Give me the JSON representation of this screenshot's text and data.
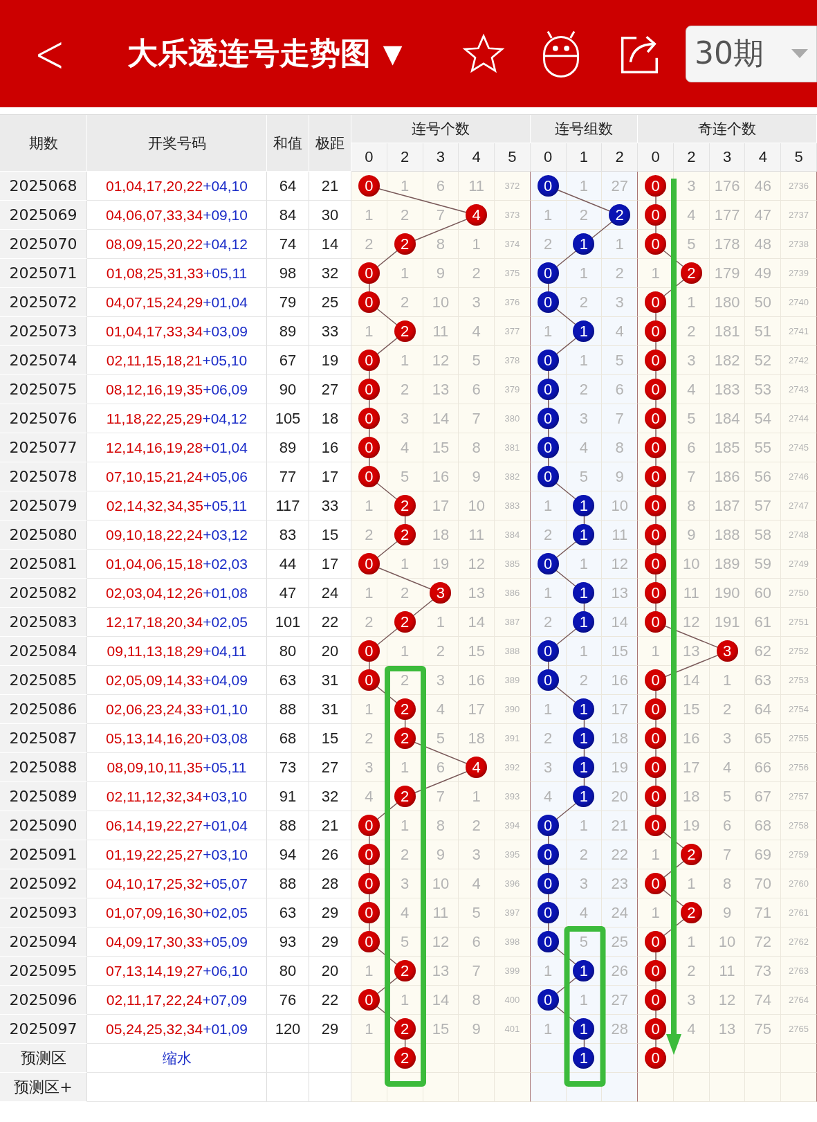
{
  "header": {
    "back": "<",
    "title": "大乐透连号走势图",
    "title_caret": "▼",
    "period": "30期"
  },
  "columns": {
    "issue": "期数",
    "numbers": "开奖号码",
    "sum": "和值",
    "span": "极距"
  },
  "groups": [
    {
      "title": "连号个数",
      "color": "#d40000",
      "columns": [
        "0",
        "2",
        "3",
        "4",
        "5"
      ]
    },
    {
      "title": "连号组数",
      "color": "#0a14b4",
      "columns": [
        "0",
        "1",
        "2"
      ]
    },
    {
      "title": "奇连个数",
      "color": "#d40000",
      "columns": [
        "0",
        "2",
        "3",
        "4",
        "5"
      ]
    }
  ],
  "rows": [
    {
      "issue": "2025068",
      "front": "01,04,17,20,22",
      "back": "+04,10",
      "sum": "64",
      "span": "21",
      "cells": [
        [
          {
            "text": "0",
            "hit": true
          },
          {
            "text": "1",
            "hit": false
          },
          {
            "text": "6",
            "hit": false
          },
          {
            "text": "11",
            "hit": false
          },
          {
            "text": "372",
            "hit": false
          }
        ],
        [
          {
            "text": "0",
            "hit": true
          },
          {
            "text": "1",
            "hit": false
          },
          {
            "text": "27",
            "hit": false
          }
        ],
        [
          {
            "text": "0",
            "hit": true
          },
          {
            "text": "3",
            "hit": false
          },
          {
            "text": "176",
            "hit": false
          },
          {
            "text": "46",
            "hit": false
          },
          {
            "text": "2736",
            "hit": false
          }
        ]
      ]
    },
    {
      "issue": "2025069",
      "front": "04,06,07,33,34",
      "back": "+09,10",
      "sum": "84",
      "span": "30",
      "cells": [
        [
          {
            "text": "1",
            "hit": false
          },
          {
            "text": "2",
            "hit": false
          },
          {
            "text": "7",
            "hit": false
          },
          {
            "text": "4",
            "hit": true
          },
          {
            "text": "373",
            "hit": false
          }
        ],
        [
          {
            "text": "1",
            "hit": false
          },
          {
            "text": "2",
            "hit": false
          },
          {
            "text": "2",
            "hit": true
          }
        ],
        [
          {
            "text": "0",
            "hit": true
          },
          {
            "text": "4",
            "hit": false
          },
          {
            "text": "177",
            "hit": false
          },
          {
            "text": "47",
            "hit": false
          },
          {
            "text": "2737",
            "hit": false
          }
        ]
      ]
    },
    {
      "issue": "2025070",
      "front": "08,09,15,20,22",
      "back": "+04,12",
      "sum": "74",
      "span": "14",
      "cells": [
        [
          {
            "text": "2",
            "hit": false
          },
          {
            "text": "2",
            "hit": true
          },
          {
            "text": "8",
            "hit": false
          },
          {
            "text": "1",
            "hit": false
          },
          {
            "text": "374",
            "hit": false
          }
        ],
        [
          {
            "text": "2",
            "hit": false
          },
          {
            "text": "1",
            "hit": true
          },
          {
            "text": "1",
            "hit": false
          }
        ],
        [
          {
            "text": "0",
            "hit": true
          },
          {
            "text": "5",
            "hit": false
          },
          {
            "text": "178",
            "hit": false
          },
          {
            "text": "48",
            "hit": false
          },
          {
            "text": "2738",
            "hit": false
          }
        ]
      ]
    },
    {
      "issue": "2025071",
      "front": "01,08,25,31,33",
      "back": "+05,11",
      "sum": "98",
      "span": "32",
      "cells": [
        [
          {
            "text": "0",
            "hit": true
          },
          {
            "text": "1",
            "hit": false
          },
          {
            "text": "9",
            "hit": false
          },
          {
            "text": "2",
            "hit": false
          },
          {
            "text": "375",
            "hit": false
          }
        ],
        [
          {
            "text": "0",
            "hit": true
          },
          {
            "text": "1",
            "hit": false
          },
          {
            "text": "2",
            "hit": false
          }
        ],
        [
          {
            "text": "1",
            "hit": false
          },
          {
            "text": "2",
            "hit": true
          },
          {
            "text": "179",
            "hit": false
          },
          {
            "text": "49",
            "hit": false
          },
          {
            "text": "2739",
            "hit": false
          }
        ]
      ]
    },
    {
      "issue": "2025072",
      "front": "04,07,15,24,29",
      "back": "+01,04",
      "sum": "79",
      "span": "25",
      "cells": [
        [
          {
            "text": "0",
            "hit": true
          },
          {
            "text": "2",
            "hit": false
          },
          {
            "text": "10",
            "hit": false
          },
          {
            "text": "3",
            "hit": false
          },
          {
            "text": "376",
            "hit": false
          }
        ],
        [
          {
            "text": "0",
            "hit": true
          },
          {
            "text": "2",
            "hit": false
          },
          {
            "text": "3",
            "hit": false
          }
        ],
        [
          {
            "text": "0",
            "hit": true
          },
          {
            "text": "1",
            "hit": false
          },
          {
            "text": "180",
            "hit": false
          },
          {
            "text": "50",
            "hit": false
          },
          {
            "text": "2740",
            "hit": false
          }
        ]
      ]
    },
    {
      "issue": "2025073",
      "front": "01,04,17,33,34",
      "back": "+03,09",
      "sum": "89",
      "span": "33",
      "cells": [
        [
          {
            "text": "1",
            "hit": false
          },
          {
            "text": "2",
            "hit": true
          },
          {
            "text": "11",
            "hit": false
          },
          {
            "text": "4",
            "hit": false
          },
          {
            "text": "377",
            "hit": false
          }
        ],
        [
          {
            "text": "1",
            "hit": false
          },
          {
            "text": "1",
            "hit": true
          },
          {
            "text": "4",
            "hit": false
          }
        ],
        [
          {
            "text": "0",
            "hit": true
          },
          {
            "text": "2",
            "hit": false
          },
          {
            "text": "181",
            "hit": false
          },
          {
            "text": "51",
            "hit": false
          },
          {
            "text": "2741",
            "hit": false
          }
        ]
      ]
    },
    {
      "issue": "2025074",
      "front": "02,11,15,18,21",
      "back": "+05,10",
      "sum": "67",
      "span": "19",
      "cells": [
        [
          {
            "text": "0",
            "hit": true
          },
          {
            "text": "1",
            "hit": false
          },
          {
            "text": "12",
            "hit": false
          },
          {
            "text": "5",
            "hit": false
          },
          {
            "text": "378",
            "hit": false
          }
        ],
        [
          {
            "text": "0",
            "hit": true
          },
          {
            "text": "1",
            "hit": false
          },
          {
            "text": "5",
            "hit": false
          }
        ],
        [
          {
            "text": "0",
            "hit": true
          },
          {
            "text": "3",
            "hit": false
          },
          {
            "text": "182",
            "hit": false
          },
          {
            "text": "52",
            "hit": false
          },
          {
            "text": "2742",
            "hit": false
          }
        ]
      ]
    },
    {
      "issue": "2025075",
      "front": "08,12,16,19,35",
      "back": "+06,09",
      "sum": "90",
      "span": "27",
      "cells": [
        [
          {
            "text": "0",
            "hit": true
          },
          {
            "text": "2",
            "hit": false
          },
          {
            "text": "13",
            "hit": false
          },
          {
            "text": "6",
            "hit": false
          },
          {
            "text": "379",
            "hit": false
          }
        ],
        [
          {
            "text": "0",
            "hit": true
          },
          {
            "text": "2",
            "hit": false
          },
          {
            "text": "6",
            "hit": false
          }
        ],
        [
          {
            "text": "0",
            "hit": true
          },
          {
            "text": "4",
            "hit": false
          },
          {
            "text": "183",
            "hit": false
          },
          {
            "text": "53",
            "hit": false
          },
          {
            "text": "2743",
            "hit": false
          }
        ]
      ]
    },
    {
      "issue": "2025076",
      "front": "11,18,22,25,29",
      "back": "+04,12",
      "sum": "105",
      "span": "18",
      "cells": [
        [
          {
            "text": "0",
            "hit": true
          },
          {
            "text": "3",
            "hit": false
          },
          {
            "text": "14",
            "hit": false
          },
          {
            "text": "7",
            "hit": false
          },
          {
            "text": "380",
            "hit": false
          }
        ],
        [
          {
            "text": "0",
            "hit": true
          },
          {
            "text": "3",
            "hit": false
          },
          {
            "text": "7",
            "hit": false
          }
        ],
        [
          {
            "text": "0",
            "hit": true
          },
          {
            "text": "5",
            "hit": false
          },
          {
            "text": "184",
            "hit": false
          },
          {
            "text": "54",
            "hit": false
          },
          {
            "text": "2744",
            "hit": false
          }
        ]
      ]
    },
    {
      "issue": "2025077",
      "front": "12,14,16,19,28",
      "back": "+01,04",
      "sum": "89",
      "span": "16",
      "cells": [
        [
          {
            "text": "0",
            "hit": true
          },
          {
            "text": "4",
            "hit": false
          },
          {
            "text": "15",
            "hit": false
          },
          {
            "text": "8",
            "hit": false
          },
          {
            "text": "381",
            "hit": false
          }
        ],
        [
          {
            "text": "0",
            "hit": true
          },
          {
            "text": "4",
            "hit": false
          },
          {
            "text": "8",
            "hit": false
          }
        ],
        [
          {
            "text": "0",
            "hit": true
          },
          {
            "text": "6",
            "hit": false
          },
          {
            "text": "185",
            "hit": false
          },
          {
            "text": "55",
            "hit": false
          },
          {
            "text": "2745",
            "hit": false
          }
        ]
      ]
    },
    {
      "issue": "2025078",
      "front": "07,10,15,21,24",
      "back": "+05,06",
      "sum": "77",
      "span": "17",
      "cells": [
        [
          {
            "text": "0",
            "hit": true
          },
          {
            "text": "5",
            "hit": false
          },
          {
            "text": "16",
            "hit": false
          },
          {
            "text": "9",
            "hit": false
          },
          {
            "text": "382",
            "hit": false
          }
        ],
        [
          {
            "text": "0",
            "hit": true
          },
          {
            "text": "5",
            "hit": false
          },
          {
            "text": "9",
            "hit": false
          }
        ],
        [
          {
            "text": "0",
            "hit": true
          },
          {
            "text": "7",
            "hit": false
          },
          {
            "text": "186",
            "hit": false
          },
          {
            "text": "56",
            "hit": false
          },
          {
            "text": "2746",
            "hit": false
          }
        ]
      ]
    },
    {
      "issue": "2025079",
      "front": "02,14,32,34,35",
      "back": "+05,11",
      "sum": "117",
      "span": "33",
      "cells": [
        [
          {
            "text": "1",
            "hit": false
          },
          {
            "text": "2",
            "hit": true
          },
          {
            "text": "17",
            "hit": false
          },
          {
            "text": "10",
            "hit": false
          },
          {
            "text": "383",
            "hit": false
          }
        ],
        [
          {
            "text": "1",
            "hit": false
          },
          {
            "text": "1",
            "hit": true
          },
          {
            "text": "10",
            "hit": false
          }
        ],
        [
          {
            "text": "0",
            "hit": true
          },
          {
            "text": "8",
            "hit": false
          },
          {
            "text": "187",
            "hit": false
          },
          {
            "text": "57",
            "hit": false
          },
          {
            "text": "2747",
            "hit": false
          }
        ]
      ]
    },
    {
      "issue": "2025080",
      "front": "09,10,18,22,24",
      "back": "+03,12",
      "sum": "83",
      "span": "15",
      "cells": [
        [
          {
            "text": "2",
            "hit": false
          },
          {
            "text": "2",
            "hit": true
          },
          {
            "text": "18",
            "hit": false
          },
          {
            "text": "11",
            "hit": false
          },
          {
            "text": "384",
            "hit": false
          }
        ],
        [
          {
            "text": "2",
            "hit": false
          },
          {
            "text": "1",
            "hit": true
          },
          {
            "text": "11",
            "hit": false
          }
        ],
        [
          {
            "text": "0",
            "hit": true
          },
          {
            "text": "9",
            "hit": false
          },
          {
            "text": "188",
            "hit": false
          },
          {
            "text": "58",
            "hit": false
          },
          {
            "text": "2748",
            "hit": false
          }
        ]
      ]
    },
    {
      "issue": "2025081",
      "front": "01,04,06,15,18",
      "back": "+02,03",
      "sum": "44",
      "span": "17",
      "cells": [
        [
          {
            "text": "0",
            "hit": true
          },
          {
            "text": "1",
            "hit": false
          },
          {
            "text": "19",
            "hit": false
          },
          {
            "text": "12",
            "hit": false
          },
          {
            "text": "385",
            "hit": false
          }
        ],
        [
          {
            "text": "0",
            "hit": true
          },
          {
            "text": "1",
            "hit": false
          },
          {
            "text": "12",
            "hit": false
          }
        ],
        [
          {
            "text": "0",
            "hit": true
          },
          {
            "text": "10",
            "hit": false
          },
          {
            "text": "189",
            "hit": false
          },
          {
            "text": "59",
            "hit": false
          },
          {
            "text": "2749",
            "hit": false
          }
        ]
      ]
    },
    {
      "issue": "2025082",
      "front": "02,03,04,12,26",
      "back": "+01,08",
      "sum": "47",
      "span": "24",
      "cells": [
        [
          {
            "text": "1",
            "hit": false
          },
          {
            "text": "2",
            "hit": false
          },
          {
            "text": "3",
            "hit": true
          },
          {
            "text": "13",
            "hit": false
          },
          {
            "text": "386",
            "hit": false
          }
        ],
        [
          {
            "text": "1",
            "hit": false
          },
          {
            "text": "1",
            "hit": true
          },
          {
            "text": "13",
            "hit": false
          }
        ],
        [
          {
            "text": "0",
            "hit": true
          },
          {
            "text": "11",
            "hit": false
          },
          {
            "text": "190",
            "hit": false
          },
          {
            "text": "60",
            "hit": false
          },
          {
            "text": "2750",
            "hit": false
          }
        ]
      ]
    },
    {
      "issue": "2025083",
      "front": "12,17,18,20,34",
      "back": "+02,05",
      "sum": "101",
      "span": "22",
      "cells": [
        [
          {
            "text": "2",
            "hit": false
          },
          {
            "text": "2",
            "hit": true
          },
          {
            "text": "1",
            "hit": false
          },
          {
            "text": "14",
            "hit": false
          },
          {
            "text": "387",
            "hit": false
          }
        ],
        [
          {
            "text": "2",
            "hit": false
          },
          {
            "text": "1",
            "hit": true
          },
          {
            "text": "14",
            "hit": false
          }
        ],
        [
          {
            "text": "0",
            "hit": true
          },
          {
            "text": "12",
            "hit": false
          },
          {
            "text": "191",
            "hit": false
          },
          {
            "text": "61",
            "hit": false
          },
          {
            "text": "2751",
            "hit": false
          }
        ]
      ]
    },
    {
      "issue": "2025084",
      "front": "09,11,13,18,29",
      "back": "+04,11",
      "sum": "80",
      "span": "20",
      "cells": [
        [
          {
            "text": "0",
            "hit": true
          },
          {
            "text": "1",
            "hit": false
          },
          {
            "text": "2",
            "hit": false
          },
          {
            "text": "15",
            "hit": false
          },
          {
            "text": "388",
            "hit": false
          }
        ],
        [
          {
            "text": "0",
            "hit": true
          },
          {
            "text": "1",
            "hit": false
          },
          {
            "text": "15",
            "hit": false
          }
        ],
        [
          {
            "text": "1",
            "hit": false
          },
          {
            "text": "13",
            "hit": false
          },
          {
            "text": "3",
            "hit": true
          },
          {
            "text": "62",
            "hit": false
          },
          {
            "text": "2752",
            "hit": false
          }
        ]
      ]
    },
    {
      "issue": "2025085",
      "front": "02,05,09,14,33",
      "back": "+04,09",
      "sum": "63",
      "span": "31",
      "cells": [
        [
          {
            "text": "0",
            "hit": true
          },
          {
            "text": "2",
            "hit": false
          },
          {
            "text": "3",
            "hit": false
          },
          {
            "text": "16",
            "hit": false
          },
          {
            "text": "389",
            "hit": false
          }
        ],
        [
          {
            "text": "0",
            "hit": true
          },
          {
            "text": "2",
            "hit": false
          },
          {
            "text": "16",
            "hit": false
          }
        ],
        [
          {
            "text": "0",
            "hit": true
          },
          {
            "text": "14",
            "hit": false
          },
          {
            "text": "1",
            "hit": false
          },
          {
            "text": "63",
            "hit": false
          },
          {
            "text": "2753",
            "hit": false
          }
        ]
      ]
    },
    {
      "issue": "2025086",
      "front": "02,06,23,24,33",
      "back": "+01,10",
      "sum": "88",
      "span": "31",
      "cells": [
        [
          {
            "text": "1",
            "hit": false
          },
          {
            "text": "2",
            "hit": true
          },
          {
            "text": "4",
            "hit": false
          },
          {
            "text": "17",
            "hit": false
          },
          {
            "text": "390",
            "hit": false
          }
        ],
        [
          {
            "text": "1",
            "hit": false
          },
          {
            "text": "1",
            "hit": true
          },
          {
            "text": "17",
            "hit": false
          }
        ],
        [
          {
            "text": "0",
            "hit": true
          },
          {
            "text": "15",
            "hit": false
          },
          {
            "text": "2",
            "hit": false
          },
          {
            "text": "64",
            "hit": false
          },
          {
            "text": "2754",
            "hit": false
          }
        ]
      ]
    },
    {
      "issue": "2025087",
      "front": "05,13,14,16,20",
      "back": "+03,08",
      "sum": "68",
      "span": "15",
      "cells": [
        [
          {
            "text": "2",
            "hit": false
          },
          {
            "text": "2",
            "hit": true
          },
          {
            "text": "5",
            "hit": false
          },
          {
            "text": "18",
            "hit": false
          },
          {
            "text": "391",
            "hit": false
          }
        ],
        [
          {
            "text": "2",
            "hit": false
          },
          {
            "text": "1",
            "hit": true
          },
          {
            "text": "18",
            "hit": false
          }
        ],
        [
          {
            "text": "0",
            "hit": true
          },
          {
            "text": "16",
            "hit": false
          },
          {
            "text": "3",
            "hit": false
          },
          {
            "text": "65",
            "hit": false
          },
          {
            "text": "2755",
            "hit": false
          }
        ]
      ]
    },
    {
      "issue": "2025088",
      "front": "08,09,10,11,35",
      "back": "+05,11",
      "sum": "73",
      "span": "27",
      "cells": [
        [
          {
            "text": "3",
            "hit": false
          },
          {
            "text": "1",
            "hit": false
          },
          {
            "text": "6",
            "hit": false
          },
          {
            "text": "4",
            "hit": true
          },
          {
            "text": "392",
            "hit": false
          }
        ],
        [
          {
            "text": "3",
            "hit": false
          },
          {
            "text": "1",
            "hit": true
          },
          {
            "text": "19",
            "hit": false
          }
        ],
        [
          {
            "text": "0",
            "hit": true
          },
          {
            "text": "17",
            "hit": false
          },
          {
            "text": "4",
            "hit": false
          },
          {
            "text": "66",
            "hit": false
          },
          {
            "text": "2756",
            "hit": false
          }
        ]
      ]
    },
    {
      "issue": "2025089",
      "front": "02,11,12,32,34",
      "back": "+03,10",
      "sum": "91",
      "span": "32",
      "cells": [
        [
          {
            "text": "4",
            "hit": false
          },
          {
            "text": "2",
            "hit": true
          },
          {
            "text": "7",
            "hit": false
          },
          {
            "text": "1",
            "hit": false
          },
          {
            "text": "393",
            "hit": false
          }
        ],
        [
          {
            "text": "4",
            "hit": false
          },
          {
            "text": "1",
            "hit": true
          },
          {
            "text": "20",
            "hit": false
          }
        ],
        [
          {
            "text": "0",
            "hit": true
          },
          {
            "text": "18",
            "hit": false
          },
          {
            "text": "5",
            "hit": false
          },
          {
            "text": "67",
            "hit": false
          },
          {
            "text": "2757",
            "hit": false
          }
        ]
      ]
    },
    {
      "issue": "2025090",
      "front": "06,14,19,22,27",
      "back": "+01,04",
      "sum": "88",
      "span": "21",
      "cells": [
        [
          {
            "text": "0",
            "hit": true
          },
          {
            "text": "1",
            "hit": false
          },
          {
            "text": "8",
            "hit": false
          },
          {
            "text": "2",
            "hit": false
          },
          {
            "text": "394",
            "hit": false
          }
        ],
        [
          {
            "text": "0",
            "hit": true
          },
          {
            "text": "1",
            "hit": false
          },
          {
            "text": "21",
            "hit": false
          }
        ],
        [
          {
            "text": "0",
            "hit": true
          },
          {
            "text": "19",
            "hit": false
          },
          {
            "text": "6",
            "hit": false
          },
          {
            "text": "68",
            "hit": false
          },
          {
            "text": "2758",
            "hit": false
          }
        ]
      ]
    },
    {
      "issue": "2025091",
      "front": "01,19,22,25,27",
      "back": "+03,10",
      "sum": "94",
      "span": "26",
      "cells": [
        [
          {
            "text": "0",
            "hit": true
          },
          {
            "text": "2",
            "hit": false
          },
          {
            "text": "9",
            "hit": false
          },
          {
            "text": "3",
            "hit": false
          },
          {
            "text": "395",
            "hit": false
          }
        ],
        [
          {
            "text": "0",
            "hit": true
          },
          {
            "text": "2",
            "hit": false
          },
          {
            "text": "22",
            "hit": false
          }
        ],
        [
          {
            "text": "1",
            "hit": false
          },
          {
            "text": "2",
            "hit": true
          },
          {
            "text": "7",
            "hit": false
          },
          {
            "text": "69",
            "hit": false
          },
          {
            "text": "2759",
            "hit": false
          }
        ]
      ]
    },
    {
      "issue": "2025092",
      "front": "04,10,17,25,32",
      "back": "+05,07",
      "sum": "88",
      "span": "28",
      "cells": [
        [
          {
            "text": "0",
            "hit": true
          },
          {
            "text": "3",
            "hit": false
          },
          {
            "text": "10",
            "hit": false
          },
          {
            "text": "4",
            "hit": false
          },
          {
            "text": "396",
            "hit": false
          }
        ],
        [
          {
            "text": "0",
            "hit": true
          },
          {
            "text": "3",
            "hit": false
          },
          {
            "text": "23",
            "hit": false
          }
        ],
        [
          {
            "text": "0",
            "hit": true
          },
          {
            "text": "1",
            "hit": false
          },
          {
            "text": "8",
            "hit": false
          },
          {
            "text": "70",
            "hit": false
          },
          {
            "text": "2760",
            "hit": false
          }
        ]
      ]
    },
    {
      "issue": "2025093",
      "front": "01,07,09,16,30",
      "back": "+02,05",
      "sum": "63",
      "span": "29",
      "cells": [
        [
          {
            "text": "0",
            "hit": true
          },
          {
            "text": "4",
            "hit": false
          },
          {
            "text": "11",
            "hit": false
          },
          {
            "text": "5",
            "hit": false
          },
          {
            "text": "397",
            "hit": false
          }
        ],
        [
          {
            "text": "0",
            "hit": true
          },
          {
            "text": "4",
            "hit": false
          },
          {
            "text": "24",
            "hit": false
          }
        ],
        [
          {
            "text": "1",
            "hit": false
          },
          {
            "text": "2",
            "hit": true
          },
          {
            "text": "9",
            "hit": false
          },
          {
            "text": "71",
            "hit": false
          },
          {
            "text": "2761",
            "hit": false
          }
        ]
      ]
    },
    {
      "issue": "2025094",
      "front": "04,09,17,30,33",
      "back": "+05,09",
      "sum": "93",
      "span": "29",
      "cells": [
        [
          {
            "text": "0",
            "hit": true
          },
          {
            "text": "5",
            "hit": false
          },
          {
            "text": "12",
            "hit": false
          },
          {
            "text": "6",
            "hit": false
          },
          {
            "text": "398",
            "hit": false
          }
        ],
        [
          {
            "text": "0",
            "hit": true
          },
          {
            "text": "5",
            "hit": false
          },
          {
            "text": "25",
            "hit": false
          }
        ],
        [
          {
            "text": "0",
            "hit": true
          },
          {
            "text": "1",
            "hit": false
          },
          {
            "text": "10",
            "hit": false
          },
          {
            "text": "72",
            "hit": false
          },
          {
            "text": "2762",
            "hit": false
          }
        ]
      ]
    },
    {
      "issue": "2025095",
      "front": "07,13,14,19,27",
      "back": "+06,10",
      "sum": "80",
      "span": "20",
      "cells": [
        [
          {
            "text": "1",
            "hit": false
          },
          {
            "text": "2",
            "hit": true
          },
          {
            "text": "13",
            "hit": false
          },
          {
            "text": "7",
            "hit": false
          },
          {
            "text": "399",
            "hit": false
          }
        ],
        [
          {
            "text": "1",
            "hit": false
          },
          {
            "text": "1",
            "hit": true
          },
          {
            "text": "26",
            "hit": false
          }
        ],
        [
          {
            "text": "0",
            "hit": true
          },
          {
            "text": "2",
            "hit": false
          },
          {
            "text": "11",
            "hit": false
          },
          {
            "text": "73",
            "hit": false
          },
          {
            "text": "2763",
            "hit": false
          }
        ]
      ]
    },
    {
      "issue": "2025096",
      "front": "02,11,17,22,24",
      "back": "+07,09",
      "sum": "76",
      "span": "22",
      "cells": [
        [
          {
            "text": "0",
            "hit": true
          },
          {
            "text": "1",
            "hit": false
          },
          {
            "text": "14",
            "hit": false
          },
          {
            "text": "8",
            "hit": false
          },
          {
            "text": "400",
            "hit": false
          }
        ],
        [
          {
            "text": "0",
            "hit": true
          },
          {
            "text": "1",
            "hit": false
          },
          {
            "text": "27",
            "hit": false
          }
        ],
        [
          {
            "text": "0",
            "hit": true
          },
          {
            "text": "3",
            "hit": false
          },
          {
            "text": "12",
            "hit": false
          },
          {
            "text": "74",
            "hit": false
          },
          {
            "text": "2764",
            "hit": false
          }
        ]
      ]
    },
    {
      "issue": "2025097",
      "front": "05,24,25,32,34",
      "back": "+01,09",
      "sum": "120",
      "span": "29",
      "cells": [
        [
          {
            "text": "1",
            "hit": false
          },
          {
            "text": "2",
            "hit": true
          },
          {
            "text": "15",
            "hit": false
          },
          {
            "text": "9",
            "hit": false
          },
          {
            "text": "401",
            "hit": false
          }
        ],
        [
          {
            "text": "1",
            "hit": false
          },
          {
            "text": "1",
            "hit": true
          },
          {
            "text": "28",
            "hit": false
          }
        ],
        [
          {
            "text": "0",
            "hit": true
          },
          {
            "text": "4",
            "hit": false
          },
          {
            "text": "13",
            "hit": false
          },
          {
            "text": "75",
            "hit": false
          },
          {
            "text": "2765",
            "hit": false
          }
        ]
      ]
    }
  ],
  "prediction": {
    "label": "预测区",
    "note": "缩水",
    "cells": [
      [
        null,
        {
          "text": "2",
          "hit": true
        },
        null,
        null,
        null
      ],
      [
        null,
        {
          "text": "1",
          "hit": true
        },
        null
      ],
      [
        {
          "text": "0",
          "hit": true
        },
        null,
        null,
        null,
        null
      ]
    ]
  },
  "prediction_plus": {
    "label": "预测区+"
  }
}
